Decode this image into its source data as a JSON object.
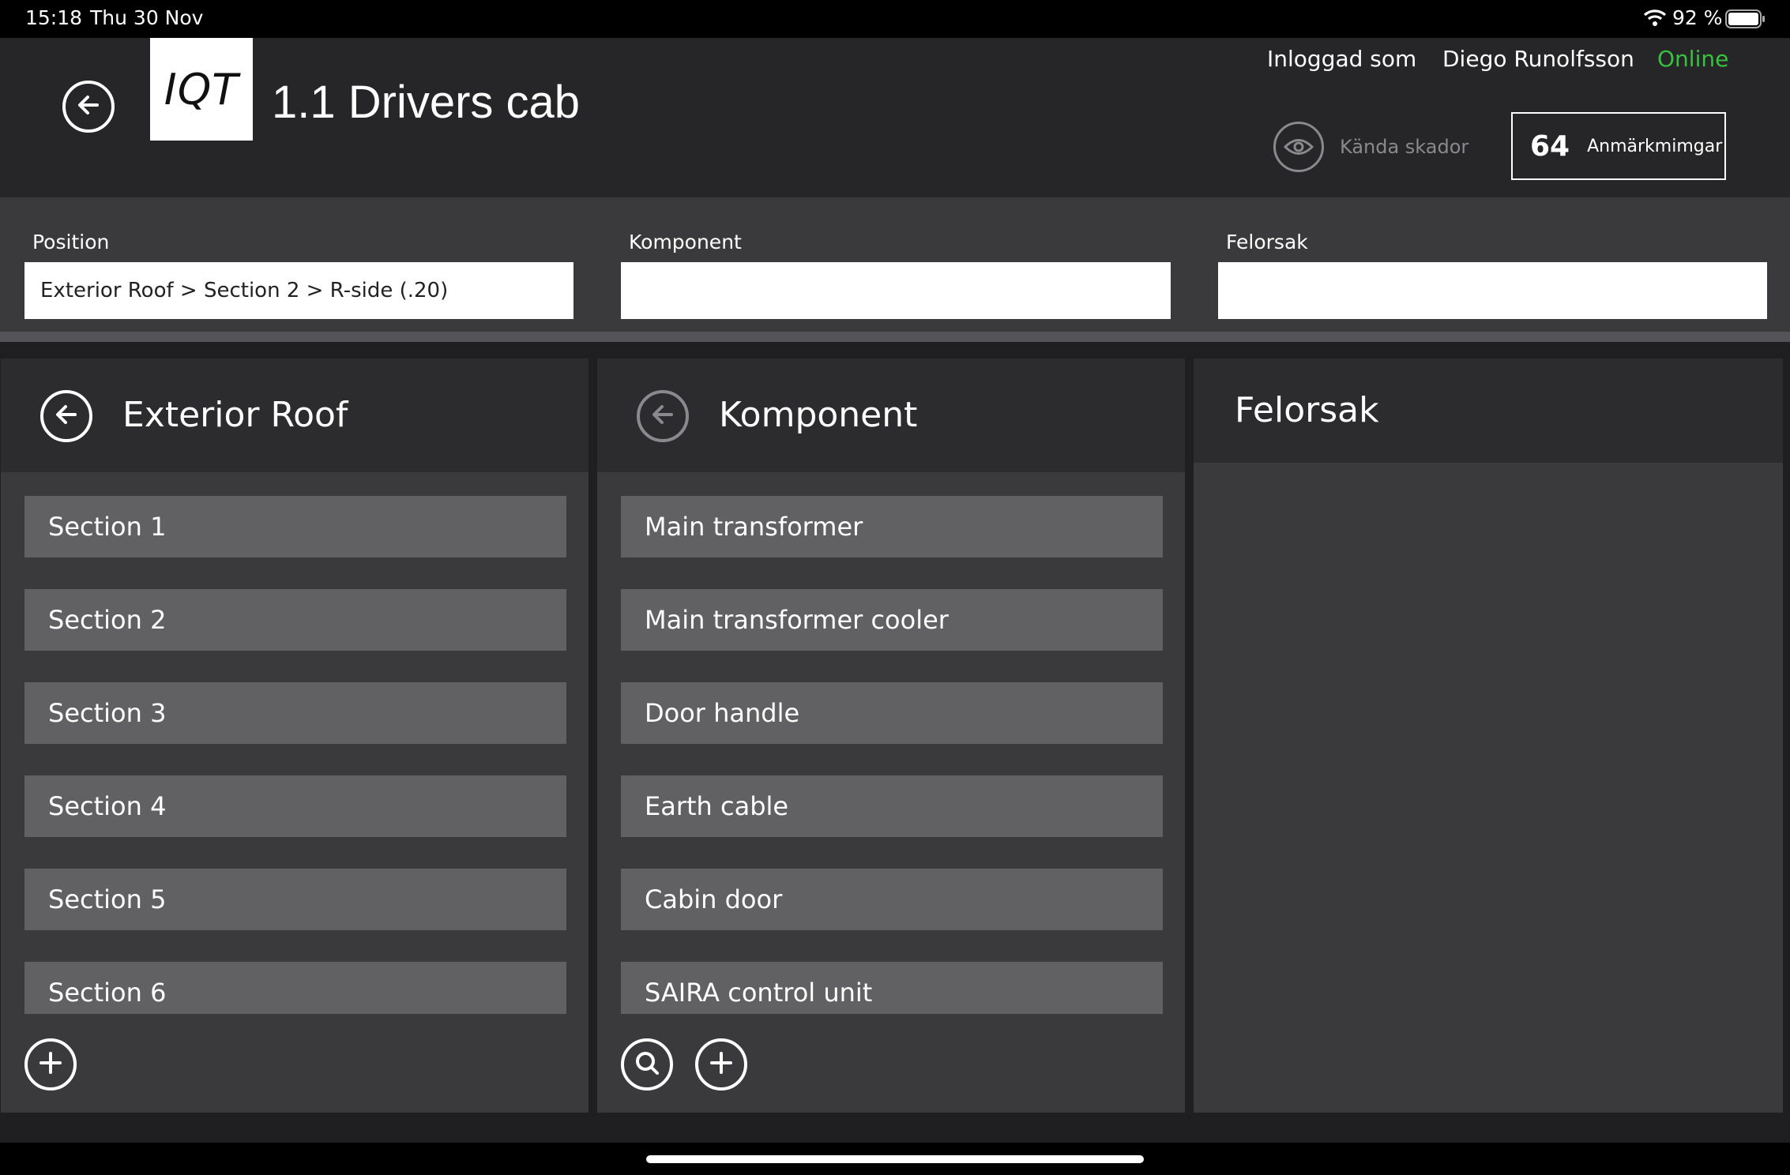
{
  "status_bar": {
    "time": "15:18",
    "date": "Thu 30 Nov",
    "battery": "92 %",
    "icons": [
      "wifi-icon",
      "battery-icon"
    ]
  },
  "header": {
    "logo_text": "IQT",
    "title": "1.1 Drivers cab",
    "logged_in_label": "Inloggad som",
    "user_name": "Diego Runolfsson",
    "status": "Online",
    "status_color": "#38c13e",
    "known_damage_label": "Kända skador",
    "remarks_count": "64",
    "remarks_label": "Anmärkmimgar"
  },
  "filters": {
    "position_label": "Position",
    "position_value": "Exterior Roof > Section 2 > R-side (.20)",
    "component_label": "Komponent",
    "component_value": "",
    "cause_label": "Felorsak",
    "cause_value": ""
  },
  "panels": {
    "position": {
      "title": "Exterior Roof",
      "items": [
        "Section 1",
        "Section 2",
        "Section 3",
        "Section 4",
        "Section 5",
        "Section 6"
      ]
    },
    "component": {
      "title": "Komponent",
      "items": [
        "Main transformer",
        "Main transformer cooler",
        "Door handle",
        "Earth cable",
        "Cabin door",
        "SAIRA control unit"
      ]
    },
    "cause": {
      "title": "Felorsak"
    }
  }
}
